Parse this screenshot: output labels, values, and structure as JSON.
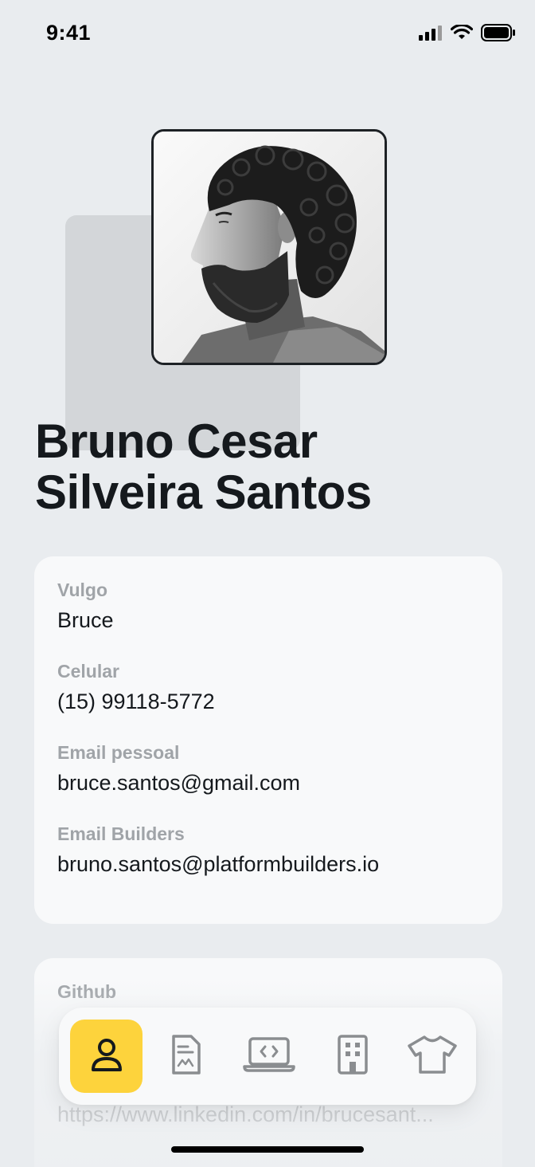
{
  "status_bar": {
    "time": "9:41",
    "icons": [
      "signal-icon",
      "wifi-icon",
      "battery-icon"
    ]
  },
  "profile": {
    "name_line1": "Bruno Cesar",
    "name_line2": "Silveira Santos",
    "photo": "profile-photo"
  },
  "contact_card": {
    "fields": [
      {
        "label": "Vulgo",
        "value": "Bruce"
      },
      {
        "label": "Celular",
        "value": "(15) 99118-5772"
      },
      {
        "label": "Email pessoal",
        "value": "bruce.santos@gmail.com"
      },
      {
        "label": "Email Builders",
        "value": "bruno.santos@platformbuilders.io"
      }
    ]
  },
  "links_card": {
    "fields": [
      {
        "label": "Github",
        "value": "https://www.linkedin.com/in/brucesant..."
      }
    ]
  },
  "bottom_nav": {
    "items": [
      {
        "icon": "user-icon",
        "active": true
      },
      {
        "icon": "document-icon",
        "active": false
      },
      {
        "icon": "laptop-code-icon",
        "active": false
      },
      {
        "icon": "building-icon",
        "active": false
      },
      {
        "icon": "tshirt-icon",
        "active": false
      }
    ]
  },
  "colors": {
    "background": "#e9ecef",
    "card": "#f8f9fa",
    "accent": "#fdd33c",
    "text": "#15191d",
    "label": "#a0a4a8"
  }
}
